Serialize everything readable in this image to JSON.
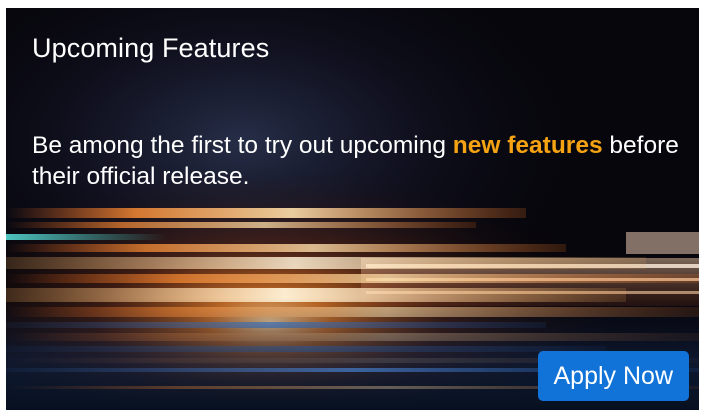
{
  "banner": {
    "title": "Upcoming Features",
    "description_before": "Be among the first to try out upcoming ",
    "description_highlight": "new features",
    "description_after": " before their official release.",
    "button_label": "Apply Now"
  },
  "colors": {
    "highlight": "#f5a312",
    "button": "#1172d8",
    "background": "#07060c"
  }
}
